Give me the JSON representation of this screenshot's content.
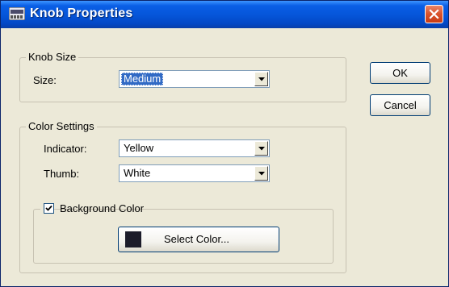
{
  "window": {
    "title": "Knob Properties",
    "icon": "app-icon",
    "close_icon": "close-icon"
  },
  "knob_size": {
    "legend": "Knob Size",
    "size_label": "Size:",
    "size_value": "Medium"
  },
  "color_settings": {
    "legend": "Color Settings",
    "indicator_label": "Indicator:",
    "indicator_value": "Yellow",
    "thumb_label": "Thumb:",
    "thumb_value": "White",
    "background": {
      "checkbox_label": "Background Color",
      "checked": true,
      "select_button_label": "Select Color...",
      "swatch_color": "#1c1c2a"
    }
  },
  "buttons": {
    "ok": "OK",
    "cancel": "Cancel"
  },
  "colors": {
    "titlebar": "#0554d8",
    "selection": "#316ac5",
    "dialog_bg": "#ece9d8"
  }
}
